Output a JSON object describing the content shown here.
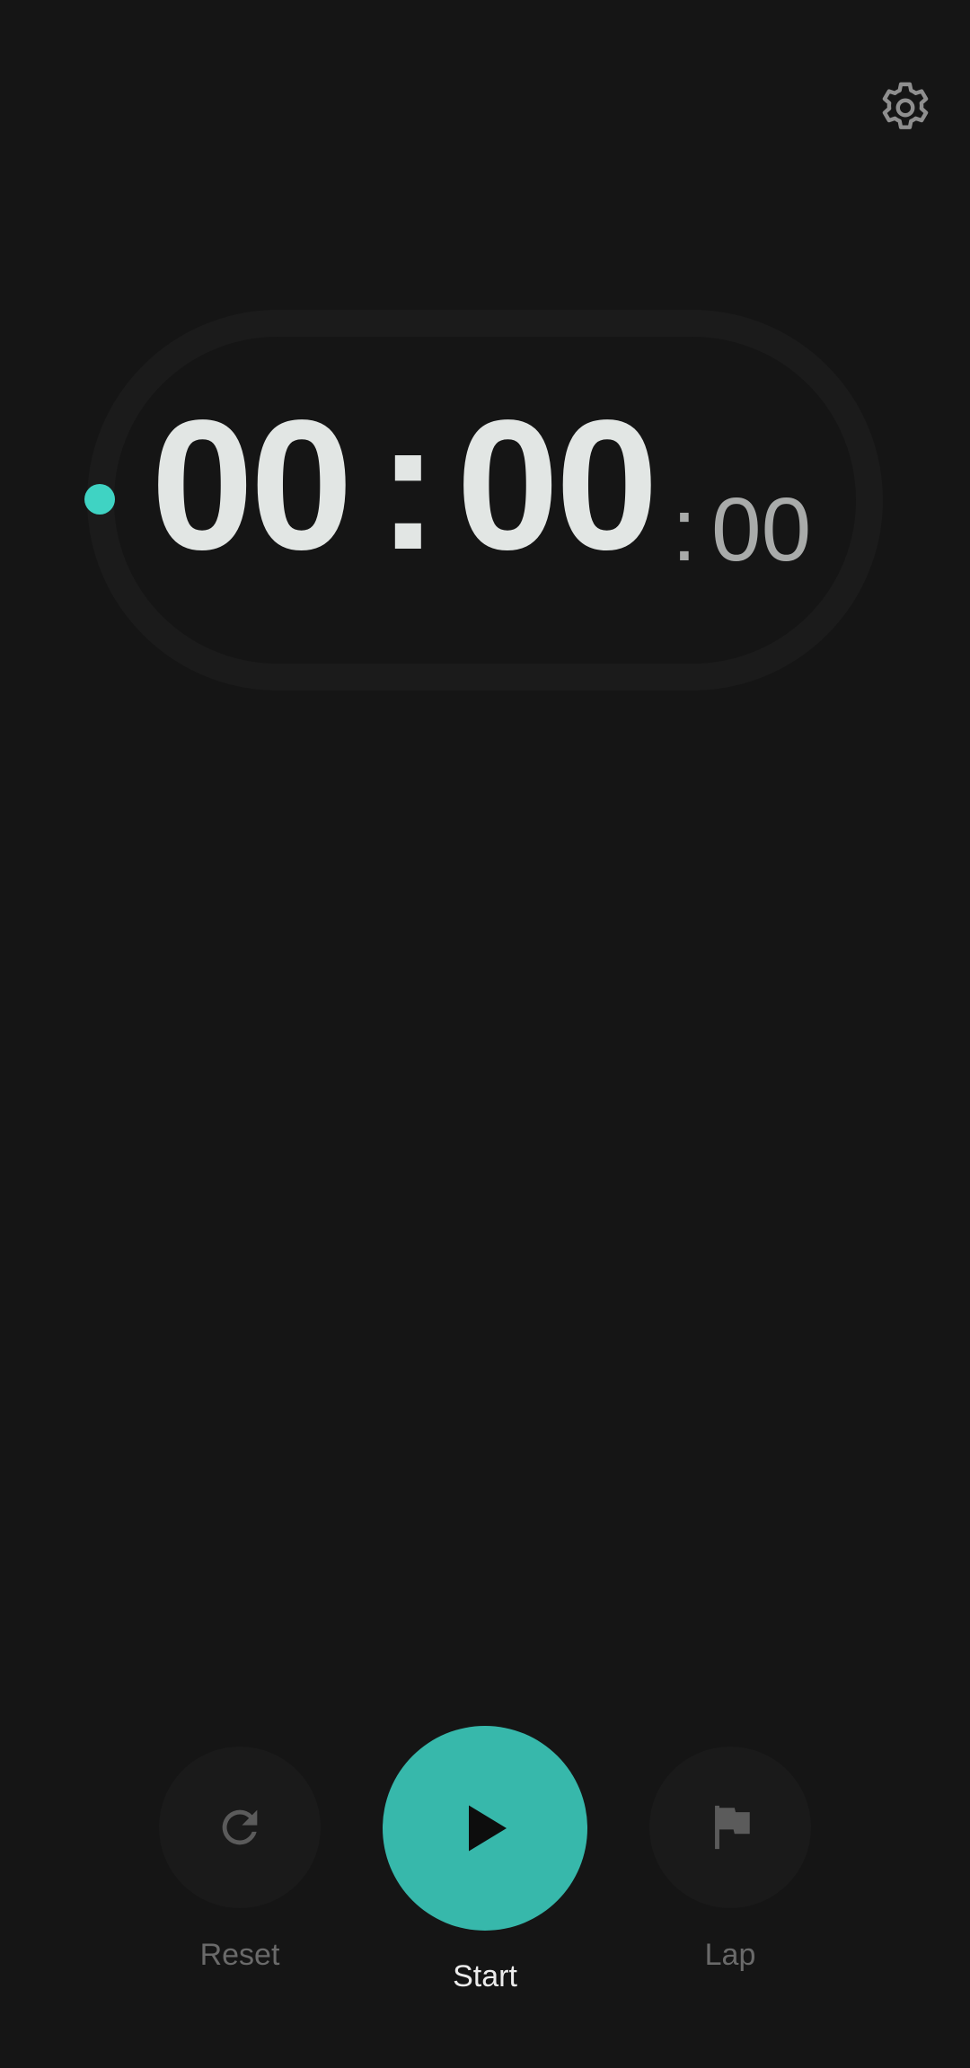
{
  "toolbar": {
    "settings_icon": "gear-icon"
  },
  "timer": {
    "minutes": "00",
    "separator": ":",
    "seconds": "00",
    "centi_separator": ":",
    "centiseconds": "00",
    "progress_fraction": 0,
    "accent_color": "#3fd3c3"
  },
  "controls": {
    "reset_label": "Reset",
    "reset_icon": "refresh-icon",
    "start_label": "Start",
    "start_icon": "play-icon",
    "lap_label": "Lap",
    "lap_icon": "flag-icon",
    "primary_color": "#37b8ab"
  }
}
